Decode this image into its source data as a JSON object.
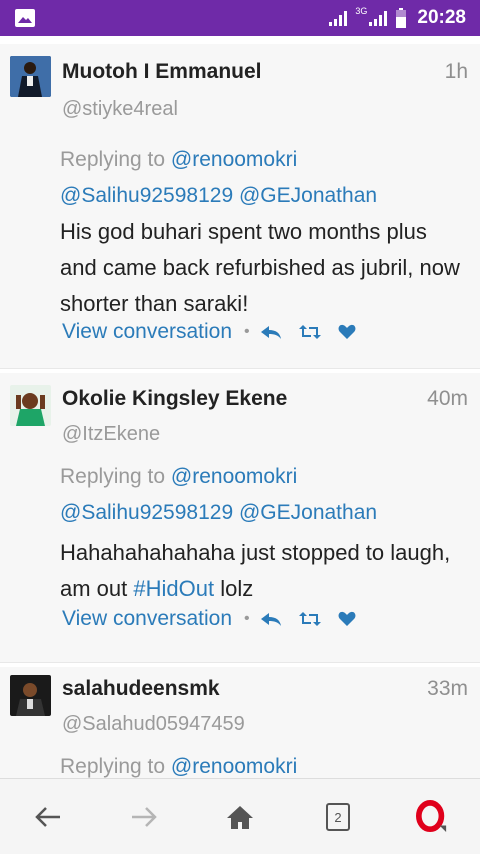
{
  "status": {
    "network": "3G",
    "time": "20:28"
  },
  "tweets": [
    {
      "name": "Muotoh I Emmanuel",
      "handle": "@stiyke4real",
      "time": "1h",
      "replying_prefix": "Replying to",
      "mentions_line1": "@renoomokri",
      "mentions_line2a": "@Salihu92598129",
      "mentions_line2b": "@GEJonathan",
      "text": "His god buhari spent two months plus and came back refurbished as jubril, now shorter than saraki!",
      "view": "View conversation"
    },
    {
      "name": "Okolie Kingsley Ekene",
      "handle": "@ItzEkene",
      "time": "40m",
      "replying_prefix": "Replying to",
      "mentions_line1": "@renoomokri",
      "mentions_line2a": "@Salihu92598129",
      "mentions_line2b": "@GEJonathan",
      "text_a": "Hahahahahahaha just stopped to laugh, am out ",
      "hashtag": "#HidOut",
      "text_b": " lolz",
      "view": "View conversation"
    },
    {
      "name": "salahudeensmk",
      "handle": "@Salahud05947459",
      "time": "33m",
      "replying_prefix": "Replying to",
      "mentions_line1": "@renoomokri"
    }
  ],
  "bottom_nav": {
    "tab_count": "2"
  },
  "colors": {
    "status_bar": "#6f2aa8",
    "link": "#2b7bb9",
    "opera_red": "#e0001b"
  }
}
